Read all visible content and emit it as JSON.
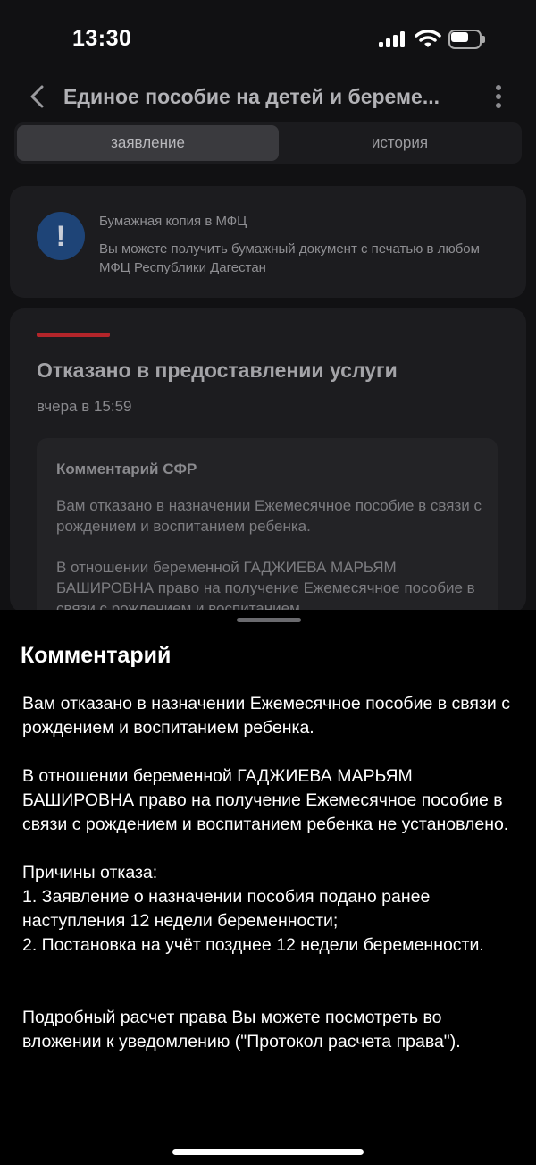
{
  "status_bar": {
    "time": "13:30"
  },
  "header": {
    "title": "Единое пособие на детей и береме..."
  },
  "tabs": [
    {
      "label": "заявление",
      "active": true
    },
    {
      "label": "история",
      "active": false
    }
  ],
  "info_card": {
    "icon": "exclamation-icon",
    "title": "Бумажная копия в МФЦ",
    "text": "Вы можете получить бумажный документ с печатью в любом МФЦ Республики Дагестан"
  },
  "status_card": {
    "accent_color": "#b3252a",
    "title": "Отказано в предоставлении услуги",
    "time": "вчера в 15:59",
    "comment_label": "Комментарий СФР",
    "comment_preview": [
      "Вам отказано в назначении Ежемесячное пособие в связи с рождением и воспитанием ребенка.",
      "В отношении беременной ГАДЖИЕВА МАРЬЯМ БАШИРОВНА право на получение Ежемесячное пособие в связи с рождением и воспитанием"
    ]
  },
  "sheet": {
    "title": "Комментарий",
    "paragraphs": [
      "Вам отказано в назначении Ежемесячное пособие в связи с рождением и воспитанием ребенка.",
      "В отношении беременной ГАДЖИЕВА МАРЬЯМ БАШИРОВНА право на получение Ежемесячное пособие в связи с рождением и воспитанием ребенка не установлено.",
      "Причины отказа:",
      "1. Заявление о назначении пособия подано ранее наступления 12 недели беременности;",
      "2. Постановка на учёт позднее 12 недели беременности.",
      "Подробный расчет права Вы можете посмотреть во вложении к уведомлению (\"Протокол расчета права\")."
    ]
  }
}
